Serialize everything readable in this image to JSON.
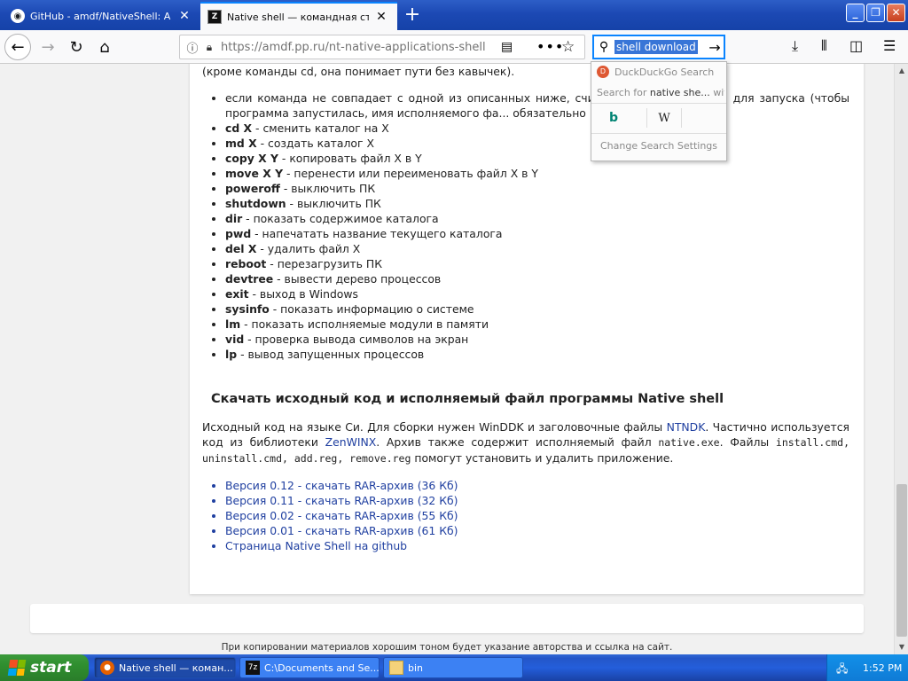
{
  "browser": {
    "tabs": [
      {
        "label": "GitHub - amdf/NativeShell: A shell"
      },
      {
        "label": "Native shell — командная строка"
      }
    ],
    "url": "https://amdf.pp.ru/nt-native-applications-shell.p",
    "search_query": "shell download"
  },
  "search_popup": {
    "engine": "DuckDuckGo Search",
    "search_for_prefix": "Search for",
    "search_for_query": "native she...",
    "search_for_suffix": "with:",
    "bing_label": "b",
    "wiki_label": "W",
    "settings": "Change Search Settings"
  },
  "page": {
    "intro_line": "(кроме команды cd, она понимает пути без кавычек).",
    "first_bullet": "если команда не совпадает с одной из описанных ниже, счит... полняемого файла для запуска (чтобы программа запустилась, имя исполняемого фа... обязательно вместе с расширением)",
    "commands": [
      {
        "cmd": "cd X",
        "desc": " - сменить каталог на X"
      },
      {
        "cmd": "md X",
        "desc": " - создать каталог X"
      },
      {
        "cmd": "copy X Y",
        "desc": " - копировать файл X в Y"
      },
      {
        "cmd": "move X Y",
        "desc": " - перенести или переименовать файл X в Y"
      },
      {
        "cmd": "poweroff",
        "desc": " - выключить ПК"
      },
      {
        "cmd": "shutdown",
        "desc": " - выключить ПК"
      },
      {
        "cmd": "dir",
        "desc": " - показать содержимое каталога"
      },
      {
        "cmd": "pwd",
        "desc": " - напечатать название текущего каталога"
      },
      {
        "cmd": "del X",
        "desc": " - удалить файл X"
      },
      {
        "cmd": "reboot",
        "desc": " - перезагрузить ПК"
      },
      {
        "cmd": "devtree",
        "desc": " - вывести дерево процессов"
      },
      {
        "cmd": "exit",
        "desc": " - выход в Windows"
      },
      {
        "cmd": "sysinfo",
        "desc": " - показать информацию о системе"
      },
      {
        "cmd": "lm",
        "desc": " - показать исполняемые модули в памяти"
      },
      {
        "cmd": "vid",
        "desc": " - проверка вывода символов на экран"
      },
      {
        "cmd": "lp",
        "desc": " - вывод запущенных процессов"
      }
    ],
    "download_heading": "Скачать исходный код и исполняемый файл программы Native shell",
    "para": {
      "t1": "Исходный код на языке Си. Для сборки нужен WinDDK и заголовочные файлы ",
      "link1": "NTNDK",
      "t2": ". Частично используется код из библиотеки ",
      "link2": "ZenWINX",
      "t3": ". Архив также содержит исполняемый файл ",
      "code1": "native.exe",
      "t4": ". Файлы ",
      "code2": "install.cmd, uninstall.cmd, add.reg, remove.reg",
      "t5": " помогут установить и удалить приложение."
    },
    "downloads": [
      "Версия 0.12 - скачать RAR-архив (36 Кб)",
      "Версия 0.11 - скачать RAR-архив (32 Кб)",
      "Версия 0.02 - скачать RAR-архив (55 Кб)",
      "Версия 0.01 - скачать RAR-архив (61 Кб)",
      "Страница Native Shell на github"
    ],
    "copyright": "При копировании материалов хорошим тоном будет указание авторства и ссылка на сайт."
  },
  "taskbar": {
    "start": "start",
    "tasks": [
      {
        "label": "Native shell — коман..."
      },
      {
        "label": "C:\\Documents and Se..."
      },
      {
        "label": "bin"
      }
    ],
    "clock": "1:52 PM"
  }
}
